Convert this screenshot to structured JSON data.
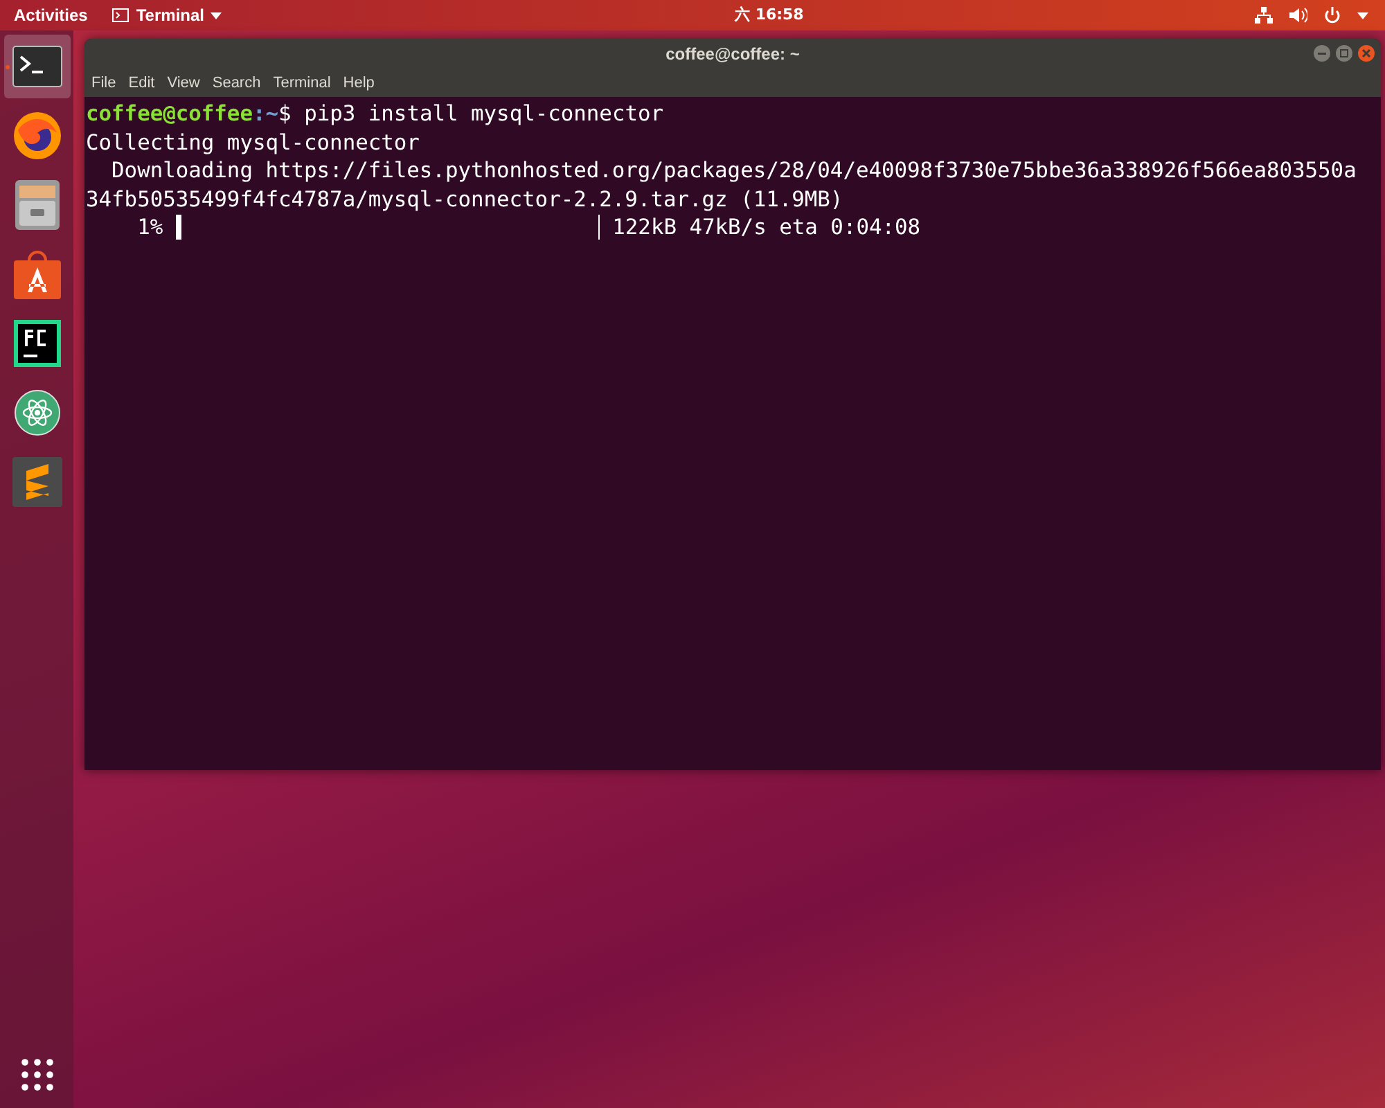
{
  "top_bar": {
    "activities": "Activities",
    "app_menu": "Terminal",
    "clock": "六 16:58"
  },
  "dock": {
    "items": [
      {
        "kind": "terminal",
        "selected": true
      },
      {
        "kind": "browser",
        "selected": false
      },
      {
        "kind": "files",
        "selected": false
      },
      {
        "kind": "store",
        "selected": false
      },
      {
        "kind": "ide",
        "selected": false
      },
      {
        "kind": "atom",
        "selected": false
      },
      {
        "kind": "editor",
        "selected": false
      }
    ]
  },
  "window": {
    "title": "coffee@coffee: ~",
    "menu": [
      "File",
      "Edit",
      "View",
      "Search",
      "Terminal",
      "Help"
    ]
  },
  "terminal": {
    "prompt_user": "coffee@coffee",
    "prompt_path": ":~",
    "prompt_symbol": "$",
    "command": " pip3 install mysql-connector",
    "lines": [
      "Collecting mysql-connector",
      "  Downloading https://files.pythonhosted.org/packages/28/04/e40098f3730e75bbe36a338926f566ea803550a",
      "34fb50535499f4fc4787a/mysql-connector-2.2.9.tar.gz (11.9MB)"
    ],
    "progress": {
      "percent": "    1% ",
      "level": 0.01,
      "stats": " 122kB 47kB/s eta 0:04:08"
    }
  }
}
